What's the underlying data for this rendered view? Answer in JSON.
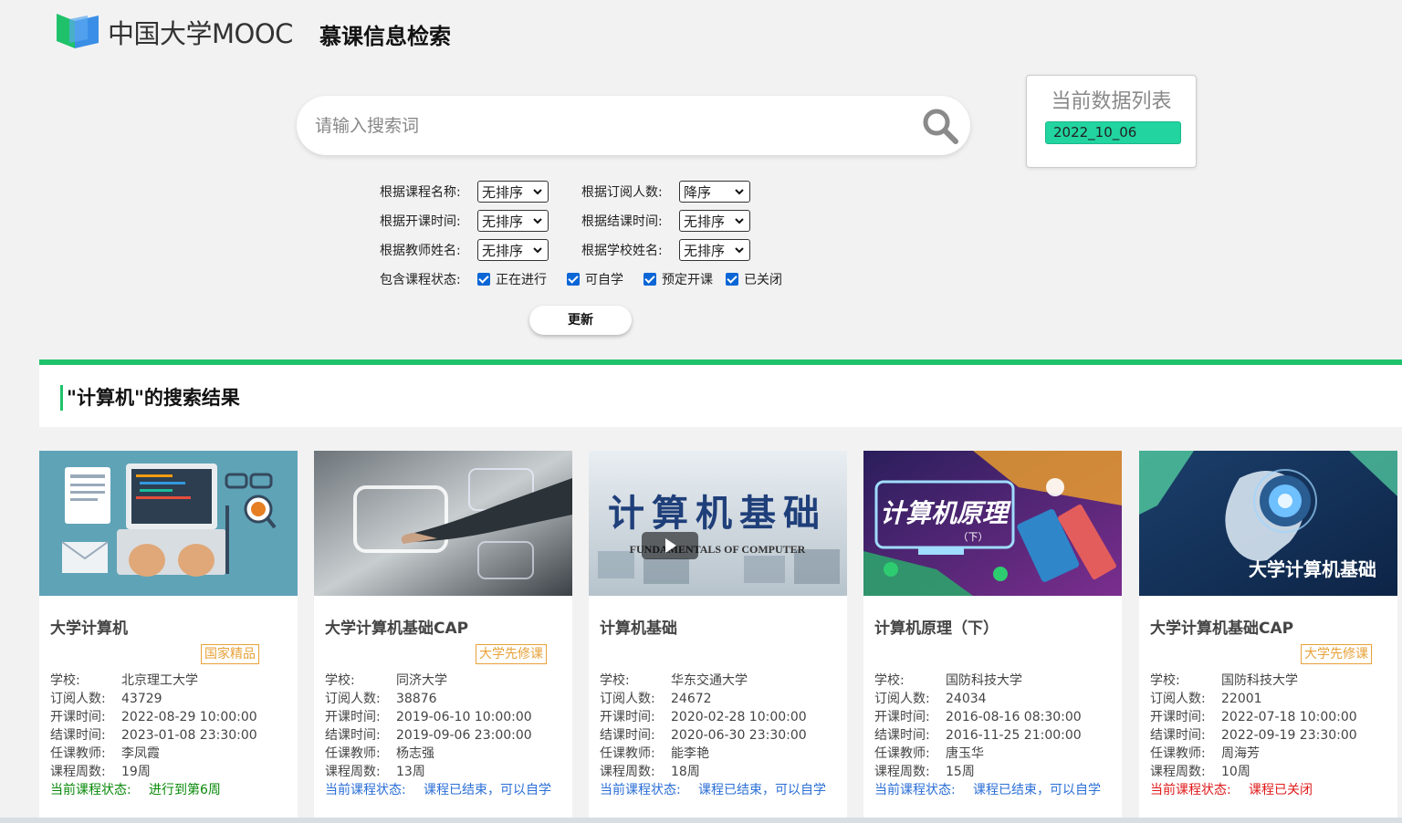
{
  "header": {
    "logo_text": "中国大学MOOC",
    "page_title": "慕课信息检索"
  },
  "search": {
    "placeholder": "请输入搜索词",
    "value": ""
  },
  "datalist": {
    "title": "当前数据列表",
    "items": [
      "2022_10_06"
    ]
  },
  "filters": {
    "sort_course_name": {
      "label": "根据课程名称:",
      "value": "无排序"
    },
    "sort_subscribers": {
      "label": "根据订阅人数:",
      "value": "降序"
    },
    "sort_start_time": {
      "label": "根据开课时间:",
      "value": "无排序"
    },
    "sort_end_time": {
      "label": "根据结课时间:",
      "value": "无排序"
    },
    "sort_teacher": {
      "label": "根据教师姓名:",
      "value": "无排序"
    },
    "sort_school": {
      "label": "根据学校姓名:",
      "value": "无排序"
    },
    "status_label": "包含课程状态:",
    "statuses": [
      {
        "label": "正在进行",
        "checked": true
      },
      {
        "label": "可自学",
        "checked": true
      },
      {
        "label": "预定开课",
        "checked": true
      },
      {
        "label": "已关闭",
        "checked": true
      }
    ],
    "update_label": "更新"
  },
  "results": {
    "title": "\"计算机\"的搜索结果"
  },
  "labels": {
    "school": "学校:",
    "subscribers": "订阅人数:",
    "start": "开课时间:",
    "end": "结课时间:",
    "teacher": "任课教师:",
    "weeks": "课程周数:",
    "status": "当前课程状态:"
  },
  "colors": {
    "accent_green": "#1fc26a",
    "datalist_item": "#21d4a0",
    "badge": "#e7a23a",
    "status_green": "#0a8a0a",
    "status_blue": "#2b6fd6",
    "status_red": "#e01b1b"
  },
  "courses": [
    {
      "title": "大学计算机",
      "badge": "国家精品",
      "school": "北京理工大学",
      "subscribers": "43729",
      "start": "2022-08-29 10:00:00",
      "end": "2023-01-08 23:30:00",
      "teacher": "李凤霞",
      "weeks": "19周",
      "status": "进行到第6周",
      "status_color": "green"
    },
    {
      "title": "大学计算机基础CAP",
      "badge": "大学先修课",
      "school": "同济大学",
      "subscribers": "38876",
      "start": "2019-06-10 10:00:00",
      "end": "2019-09-06 23:00:00",
      "teacher": "杨志强",
      "weeks": "13周",
      "status": "课程已结束，可以自学",
      "status_color": "blue"
    },
    {
      "title": "计算机基础",
      "badge": "",
      "school": "华东交通大学",
      "subscribers": "24672",
      "start": "2020-02-28 10:00:00",
      "end": "2020-06-30 23:30:00",
      "teacher": "能李艳",
      "weeks": "18周",
      "status": "课程已结束，可以自学",
      "status_color": "blue",
      "thumb_title": "计算机基础",
      "thumb_sub": "FUNDAMENTALS OF COMPUTER"
    },
    {
      "title": "计算机原理（下）",
      "badge": "",
      "school": "国防科技大学",
      "subscribers": "24034",
      "start": "2016-08-16 08:30:00",
      "end": "2016-11-25 21:00:00",
      "teacher": "唐玉华",
      "weeks": "15周",
      "status": "课程已结束，可以自学",
      "status_color": "blue",
      "thumb_title": "计算机原理",
      "thumb_sub": "（下）"
    },
    {
      "title": "大学计算机基础CAP",
      "badge": "大学先修课",
      "school": "国防科技大学",
      "subscribers": "22001",
      "start": "2022-07-18 10:00:00",
      "end": "2022-09-19 23:30:00",
      "teacher": "周海芳",
      "weeks": "10周",
      "status": "课程已关闭",
      "status_color": "red",
      "thumb_title": "大学计算机基础"
    }
  ]
}
